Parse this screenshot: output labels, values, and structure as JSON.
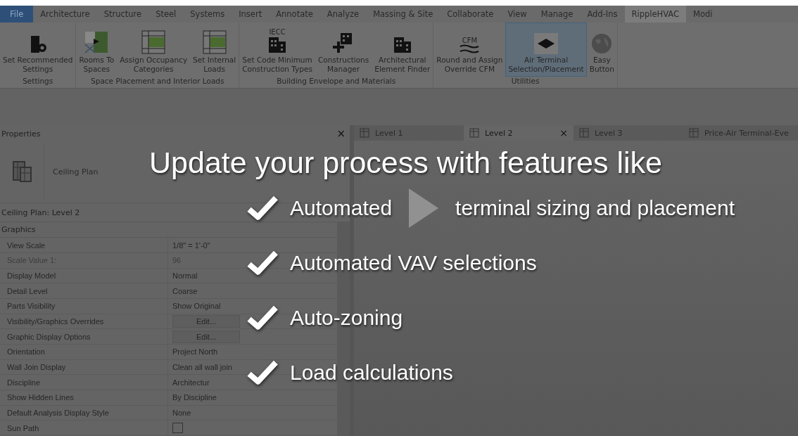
{
  "menu_tabs": [
    {
      "label": "File",
      "kind": "file",
      "selected": false
    },
    {
      "label": "Architecture",
      "kind": "tab",
      "selected": false
    },
    {
      "label": "Structure",
      "kind": "tab",
      "selected": false
    },
    {
      "label": "Steel",
      "kind": "tab",
      "selected": false
    },
    {
      "label": "Systems",
      "kind": "tab",
      "selected": false
    },
    {
      "label": "Insert",
      "kind": "tab",
      "selected": false
    },
    {
      "label": "Annotate",
      "kind": "tab",
      "selected": false
    },
    {
      "label": "Analyze",
      "kind": "tab",
      "selected": false
    },
    {
      "label": "Massing & Site",
      "kind": "tab",
      "selected": false
    },
    {
      "label": "Collaborate",
      "kind": "tab",
      "selected": false
    },
    {
      "label": "View",
      "kind": "tab",
      "selected": false
    },
    {
      "label": "Manage",
      "kind": "tab",
      "selected": false
    },
    {
      "label": "Add-Ins",
      "kind": "tab",
      "selected": false
    },
    {
      "label": "RippleHVAC",
      "kind": "tab",
      "selected": true
    },
    {
      "label": "Modi",
      "kind": "tab",
      "selected": false
    }
  ],
  "ribbon_panels": [
    {
      "label": "Settings",
      "buttons": [
        {
          "label": "Set Recommended\nSettings",
          "kind": "settings",
          "selected": false
        }
      ]
    },
    {
      "label": "Space Placement and Interior Loads",
      "buttons": [
        {
          "label": "Rooms To\nSpaces",
          "kind": "rooms",
          "selected": false
        },
        {
          "label": "Assign Occupancy\nCategories",
          "kind": "table",
          "selected": false
        },
        {
          "label": "Set Internal\nLoads",
          "kind": "table",
          "selected": false
        }
      ]
    },
    {
      "label": "Building Envelope and Materials",
      "buttons": [
        {
          "label": "Set Code Minimum\nConstruction Types",
          "kind": "code",
          "icon_text": "IECC",
          "selected": false
        },
        {
          "label": "Constructions\nManager",
          "kind": "add",
          "selected": false
        },
        {
          "label": "Architectural\nElement Finder",
          "kind": "building",
          "selected": false
        }
      ]
    },
    {
      "label": "Utilities",
      "buttons": [
        {
          "label": "Round and Assign\nOverride CFM",
          "kind": "airflow",
          "icon_text": "CFM",
          "selected": false
        },
        {
          "label": "Air Terminal\nSelection/Placement",
          "kind": "diffuser",
          "selected": true
        },
        {
          "label": "Easy\nButton",
          "kind": "globe",
          "selected": false
        }
      ]
    }
  ],
  "properties": {
    "title": "Properties",
    "close": "×",
    "type": "Ceiling Plan",
    "instance": "Ceiling Plan: Level 2",
    "group": "Graphics",
    "rows": [
      {
        "name": "View Scale",
        "value": "1/8\" = 1'-0\"",
        "kind": "text",
        "disabled": false
      },
      {
        "name": "Scale Value    1:",
        "value": "96",
        "kind": "text",
        "disabled": true
      },
      {
        "name": "Display Model",
        "value": "Normal",
        "kind": "text",
        "disabled": false
      },
      {
        "name": "Detail Level",
        "value": "Coarse",
        "kind": "text",
        "disabled": false
      },
      {
        "name": "Parts Visibility",
        "value": "Show Original",
        "kind": "text",
        "disabled": false
      },
      {
        "name": "Visibility/Graphics Overrides",
        "value": "Edit...",
        "kind": "button",
        "disabled": false
      },
      {
        "name": "Graphic Display Options",
        "value": "Edit...",
        "kind": "button",
        "disabled": false
      },
      {
        "name": "Orientation",
        "value": "Project North",
        "kind": "text",
        "disabled": false
      },
      {
        "name": "Wall Join Display",
        "value": "Clean all wall join",
        "kind": "text",
        "disabled": false
      },
      {
        "name": "Discipline",
        "value": "Architectur",
        "kind": "text",
        "disabled": false
      },
      {
        "name": "Show Hidden Lines",
        "value": "By Discipline",
        "kind": "text",
        "disabled": false
      },
      {
        "name": "Default Analysis Display Style",
        "value": "None",
        "kind": "text",
        "disabled": false
      },
      {
        "name": "Sun Path",
        "kind": "checkbox",
        "checked": false,
        "disabled": false
      }
    ]
  },
  "view_tabs": [
    {
      "label": "Level 1",
      "selected": false
    },
    {
      "label": "Level 2",
      "selected": true,
      "close": "×"
    },
    {
      "label": "Level 3",
      "selected": false
    },
    {
      "label": "Price-Air Terminal-Eve",
      "selected": false
    }
  ],
  "overlay": {
    "title": "Update your process with features like",
    "items": [
      {
        "parts": [
          "Automated",
          "terminal sizing and placement"
        ]
      },
      {
        "parts": [
          "Automated VAV selections"
        ]
      },
      {
        "parts": [
          "Auto-zoning"
        ]
      },
      {
        "parts": [
          "Load calculations"
        ]
      }
    ]
  }
}
